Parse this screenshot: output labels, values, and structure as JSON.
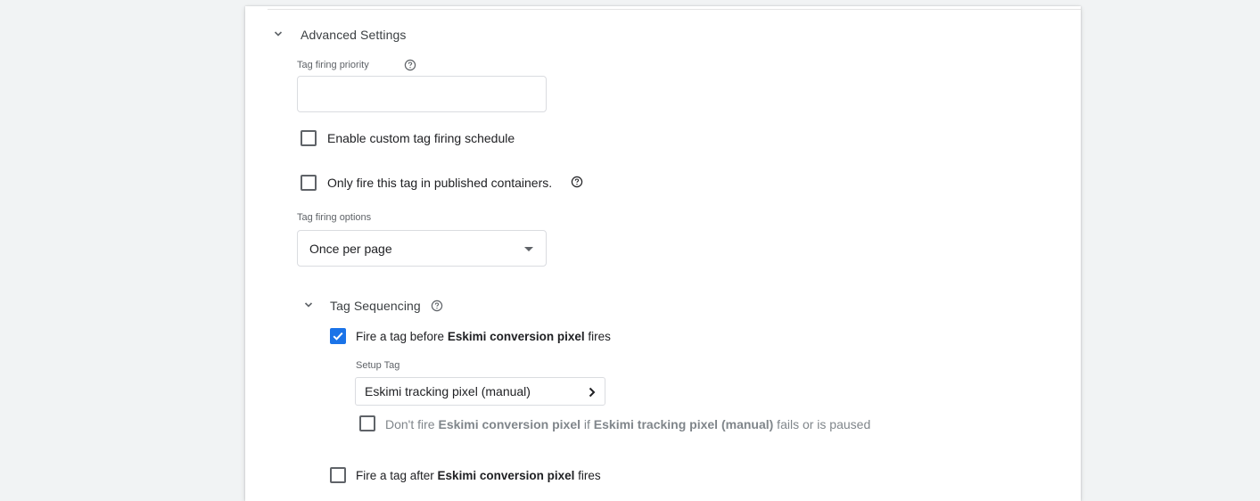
{
  "advanced_settings": {
    "title": "Advanced Settings",
    "priority": {
      "label": "Tag firing priority",
      "value": "",
      "placeholder": ""
    },
    "custom_schedule": {
      "label": "Enable custom tag firing schedule",
      "checked": false
    },
    "published_only": {
      "label": "Only fire this tag in published containers.",
      "checked": false
    },
    "firing_options": {
      "label": "Tag firing options",
      "selected": "Once per page"
    }
  },
  "tag_sequencing": {
    "title": "Tag Sequencing",
    "fire_before": {
      "checked": true,
      "prefix": "Fire a tag before ",
      "tag_name": "Eskimi conversion pixel",
      "suffix": " fires"
    },
    "setup_tag": {
      "label": "Setup Tag",
      "selected": "Eskimi tracking pixel (manual)"
    },
    "dont_fire": {
      "checked": false,
      "part1": "Don't fire ",
      "tag_name": "Eskimi conversion pixel",
      "part2": " if ",
      "setup_name": "Eskimi tracking pixel (manual)",
      "part3": " fails or is paused"
    },
    "fire_after": {
      "checked": false,
      "prefix": "Fire a tag after ",
      "tag_name": "Eskimi conversion pixel",
      "suffix": " fires"
    }
  },
  "colors": {
    "accent": "#1a73e8",
    "page_bg": "#f1f3f4",
    "card_bg": "#ffffff"
  },
  "icons": {
    "collapse": "chevron-down-icon",
    "help": "help-circle-icon",
    "dropdown": "caret-down-icon",
    "next": "chevron-right-icon",
    "check": "check-icon"
  }
}
